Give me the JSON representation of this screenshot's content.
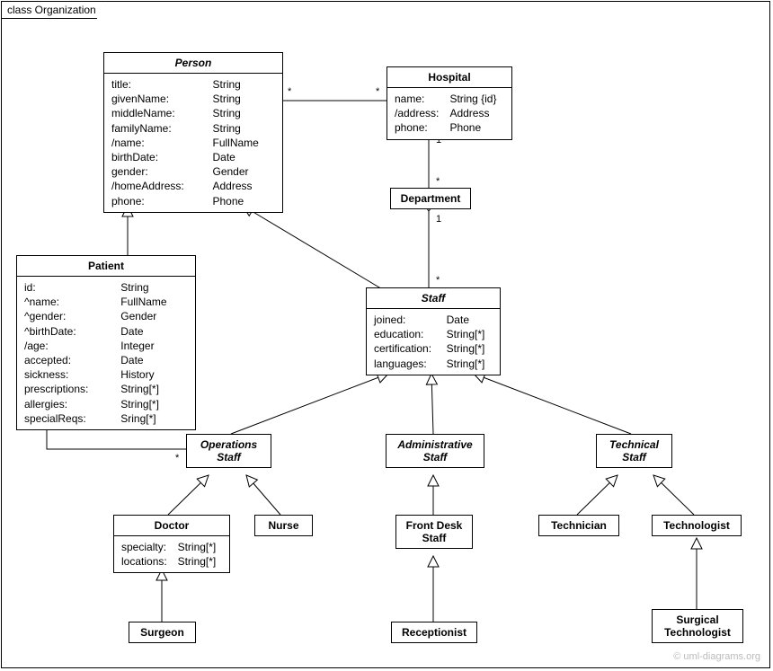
{
  "frame_title": "class Organization",
  "watermark": "© uml-diagrams.org",
  "classes": {
    "person": {
      "title": "Person",
      "attrs": [
        [
          "title:",
          "String"
        ],
        [
          "givenName:",
          "String"
        ],
        [
          "middleName:",
          "String"
        ],
        [
          "familyName:",
          "String"
        ],
        [
          "/name:",
          "FullName"
        ],
        [
          "birthDate:",
          "Date"
        ],
        [
          "gender:",
          "Gender"
        ],
        [
          "/homeAddress:",
          "Address"
        ],
        [
          "phone:",
          "Phone"
        ]
      ]
    },
    "hospital": {
      "title": "Hospital",
      "attrs": [
        [
          "name:",
          "String {id}"
        ],
        [
          "/address:",
          "Address"
        ],
        [
          "phone:",
          "Phone"
        ]
      ]
    },
    "department": {
      "title": "Department"
    },
    "patient": {
      "title": "Patient",
      "attrs": [
        [
          "id:",
          "String"
        ],
        [
          "^name:",
          "FullName"
        ],
        [
          "^gender:",
          "Gender"
        ],
        [
          "^birthDate:",
          "Date"
        ],
        [
          "/age:",
          "Integer"
        ],
        [
          "accepted:",
          "Date"
        ],
        [
          "sickness:",
          "History"
        ],
        [
          "prescriptions:",
          "String[*]"
        ],
        [
          "allergies:",
          "String[*]"
        ],
        [
          "specialReqs:",
          "Sring[*]"
        ]
      ]
    },
    "staff": {
      "title": "Staff",
      "attrs": [
        [
          "joined:",
          "Date"
        ],
        [
          "education:",
          "String[*]"
        ],
        [
          "certification:",
          "String[*]"
        ],
        [
          "languages:",
          "String[*]"
        ]
      ]
    },
    "operations_staff": {
      "title": "OperationsStaff",
      "title2lines": [
        "Operations",
        "Staff"
      ]
    },
    "administrative_staff": {
      "title": "AdministrativeStaff",
      "title2lines": [
        "Administrative",
        "Staff"
      ]
    },
    "technical_staff": {
      "title": "TechnicalStaff",
      "title2lines": [
        "Technical",
        "Staff"
      ]
    },
    "doctor": {
      "title": "Doctor",
      "attrs": [
        [
          "specialty:",
          "String[*]"
        ],
        [
          "locations:",
          "String[*]"
        ]
      ]
    },
    "nurse": {
      "title": "Nurse"
    },
    "front_desk_staff": {
      "title": "FrontDeskStaff",
      "title2lines": [
        "Front Desk",
        "Staff"
      ]
    },
    "technician": {
      "title": "Technician"
    },
    "technologist": {
      "title": "Technologist"
    },
    "surgeon": {
      "title": "Surgeon"
    },
    "receptionist": {
      "title": "Receptionist"
    },
    "surgical_technologist": {
      "title": "SurgicalTechnologist",
      "title2lines": [
        "Surgical",
        "Technologist"
      ]
    }
  },
  "multiplicities": {
    "person_hospital_left": "*",
    "person_hospital_right": "*",
    "hospital_dept_top": "1",
    "hospital_dept_bottom": "*",
    "dept_staff_top": "1",
    "dept_staff_bottom": "*",
    "patient_ops_left": "*",
    "patient_ops_right": "*"
  }
}
